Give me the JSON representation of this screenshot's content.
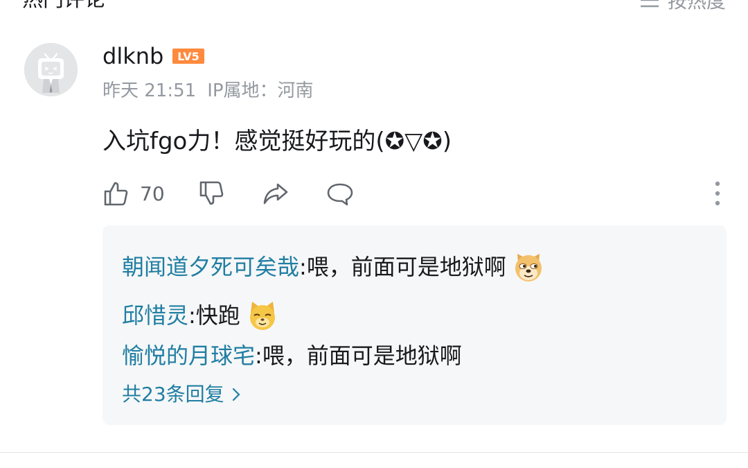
{
  "section": {
    "title": "热门评论",
    "sort_label": "按热度"
  },
  "comment": {
    "username": "dlknb",
    "level": "LV5",
    "time": "昨天 21:51",
    "ip_location": "IP属地：河南",
    "text": "入坑fgo力！感觉挺好玩的(✪▽✪)",
    "like_count": "70",
    "icons": [
      "thumbs-up-icon",
      "thumbs-down-icon",
      "share-icon",
      "comment-bubble-icon",
      "more-vertical-icon"
    ]
  },
  "replies": [
    {
      "name": "朝闻道夕死可矣哉",
      "sep": ": ",
      "text": "喂，前面可是地狱啊",
      "emoji": "doge-emoji"
    },
    {
      "name": "邱惜灵",
      "sep": ": ",
      "text": "快跑",
      "emoji": "cat-emoji"
    },
    {
      "name": "愉悦的月球宅",
      "sep": ": ",
      "text": "喂，前面可是地狱啊",
      "emoji": ""
    }
  ],
  "reply_summary": "共23条回复",
  "colors": {
    "link": "#207ea3",
    "secondary": "#9499a0",
    "level_badge": "#ff8a3d",
    "reply_bg": "#f6f7f8"
  }
}
